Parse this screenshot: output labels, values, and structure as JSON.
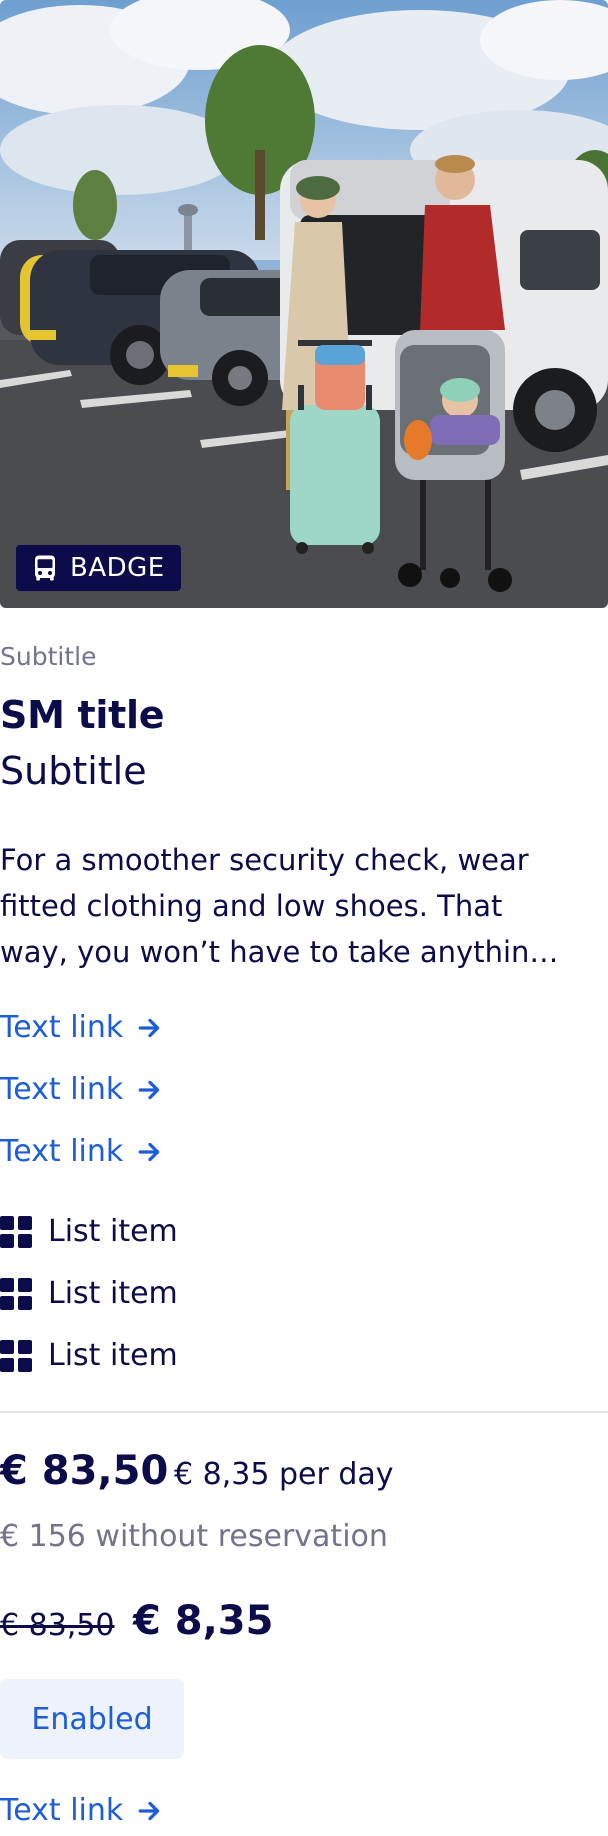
{
  "card": {
    "badge": {
      "label": "BADGE",
      "icon": "bus-icon"
    },
    "eyebrow": "Subtitle",
    "title": "SM title",
    "subtitle": "Subtitle",
    "description": "For a smoother security check, wear fitted clothing and low shoes. That way, you won’t have to take anythin…",
    "links": [
      {
        "label": "Text link",
        "icon": "arrow-right-icon"
      },
      {
        "label": "Text link",
        "icon": "arrow-right-icon"
      },
      {
        "label": "Text link",
        "icon": "arrow-right-icon"
      }
    ],
    "list_items": [
      {
        "label": "List item",
        "icon": "grid-icon"
      },
      {
        "label": "List item",
        "icon": "grid-icon"
      },
      {
        "label": "List item",
        "icon": "grid-icon"
      }
    ],
    "pricing": {
      "price": "€ 83,50",
      "per_day": "€ 8,35 per day",
      "without_reservation": "€ 156 without reservation",
      "old_price": "€ 83,50",
      "new_price": "€ 8,35"
    },
    "button": {
      "label": "Enabled"
    },
    "footer_link": {
      "label": "Text link",
      "icon": "arrow-right-icon"
    }
  },
  "colors": {
    "navy": "#0c0c4b",
    "link_blue": "#1d5ed8",
    "muted": "#73738d",
    "button_bg": "#eef2fb",
    "divider": "#e3e5ea"
  }
}
